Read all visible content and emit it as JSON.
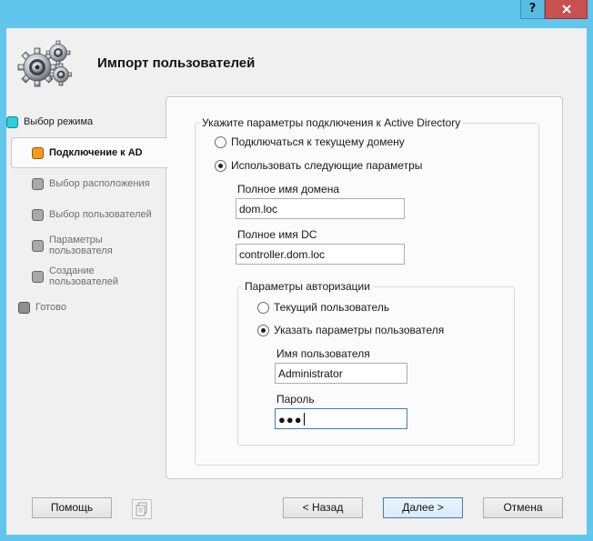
{
  "titlebar": {
    "help_label": "?",
    "close_label": "x"
  },
  "header": {
    "title": "Импорт пользователей",
    "icon": "gears-icon"
  },
  "steps": [
    {
      "label": "Выбор режима",
      "state": "done"
    },
    {
      "label": "Подключение к AD",
      "state": "active"
    },
    {
      "label": "Выбор расположения",
      "state": "pending"
    },
    {
      "label": "Выбор пользователей",
      "state": "pending"
    },
    {
      "label": "Параметры\nпользователя",
      "state": "pending"
    },
    {
      "label": "Создание\nпользователей",
      "state": "pending"
    },
    {
      "label": "Готово",
      "state": "ready"
    }
  ],
  "connection": {
    "group_title": "Укажите параметры подключения к Active Directory",
    "option_current_domain": "Подключаться к текущему домену",
    "option_custom": "Использовать следующие параметры",
    "selected": "custom",
    "domain_label": "Полное имя домена",
    "domain_value": "dom.loc",
    "dc_label": "Полное имя DC",
    "dc_value": "controller.dom.loc"
  },
  "auth": {
    "group_title": "Параметры авторизации",
    "option_current_user": "Текущий пользователь",
    "option_specify": "Указать параметры пользователя",
    "selected": "specify",
    "username_label": "Имя пользователя",
    "username_value": "Administrator",
    "password_label": "Пароль",
    "password_mask": "●●●"
  },
  "buttons": {
    "help": "Помощь",
    "back": "< Назад",
    "next": "Далее >",
    "cancel": "Отмена"
  },
  "colors": {
    "titlebar": "#62c6ec",
    "close": "#c75050",
    "step_done": "#26d0de",
    "step_active": "#f39a1c"
  }
}
